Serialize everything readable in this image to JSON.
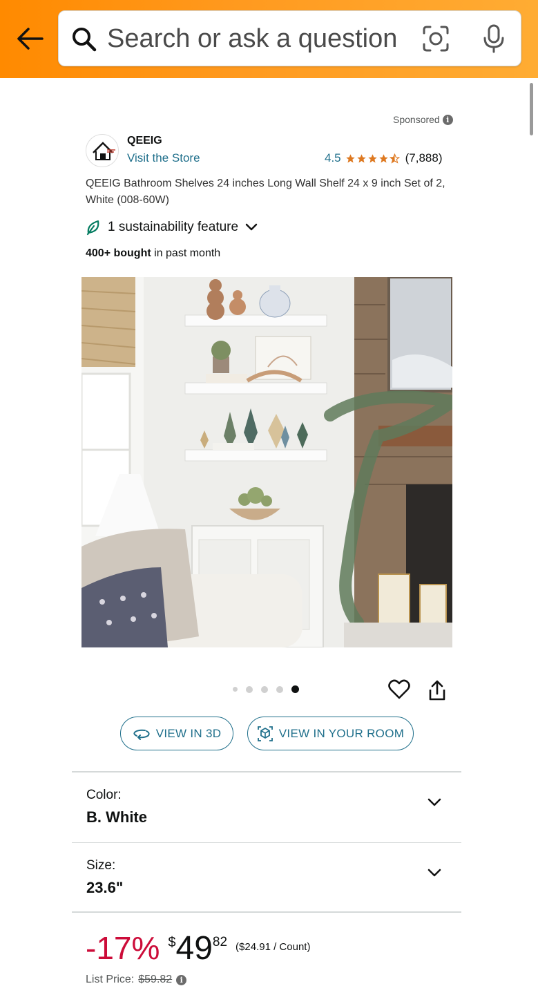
{
  "header": {
    "search_placeholder": "Search or ask a question",
    "icons": [
      "back-arrow-icon",
      "search-icon",
      "camera-lens-icon",
      "microphone-icon"
    ]
  },
  "sponsored": {
    "label": "Sponsored"
  },
  "brand": {
    "name": "QEEIG",
    "visit_store": "Visit the Store",
    "rating": "4.5",
    "stars_out_of_5": 4.5,
    "review_count": "(7,888)"
  },
  "product": {
    "title": "QEEIG Bathroom Shelves 24 inches Long Wall Shelf 24 x 9 inch Set of 2, White (008-60W)",
    "sustainability": "1 sustainability feature",
    "bought_bold": "400+ bought",
    "bought_rest": " in past month"
  },
  "gallery": {
    "image_count": 5,
    "active_index": 4
  },
  "buttons": {
    "view_3d": "VIEW IN 3D",
    "view_room": "VIEW IN YOUR ROOM"
  },
  "variants": {
    "color_label": "Color:",
    "color_value": "B. White",
    "size_label": "Size:",
    "size_value": "23.6\""
  },
  "price": {
    "discount": "-17%",
    "currency": "$",
    "whole": "49",
    "fraction": "82",
    "unit_price": "($24.91 / Count)",
    "list_price_label": "List Price:",
    "list_price_value": "$59.82"
  },
  "colors": {
    "header_orange": "#ff9a1f",
    "link_teal": "#1f6f8b",
    "star_orange": "#de7921",
    "discount_red": "#cc0c39",
    "eco_green": "#067d62"
  }
}
